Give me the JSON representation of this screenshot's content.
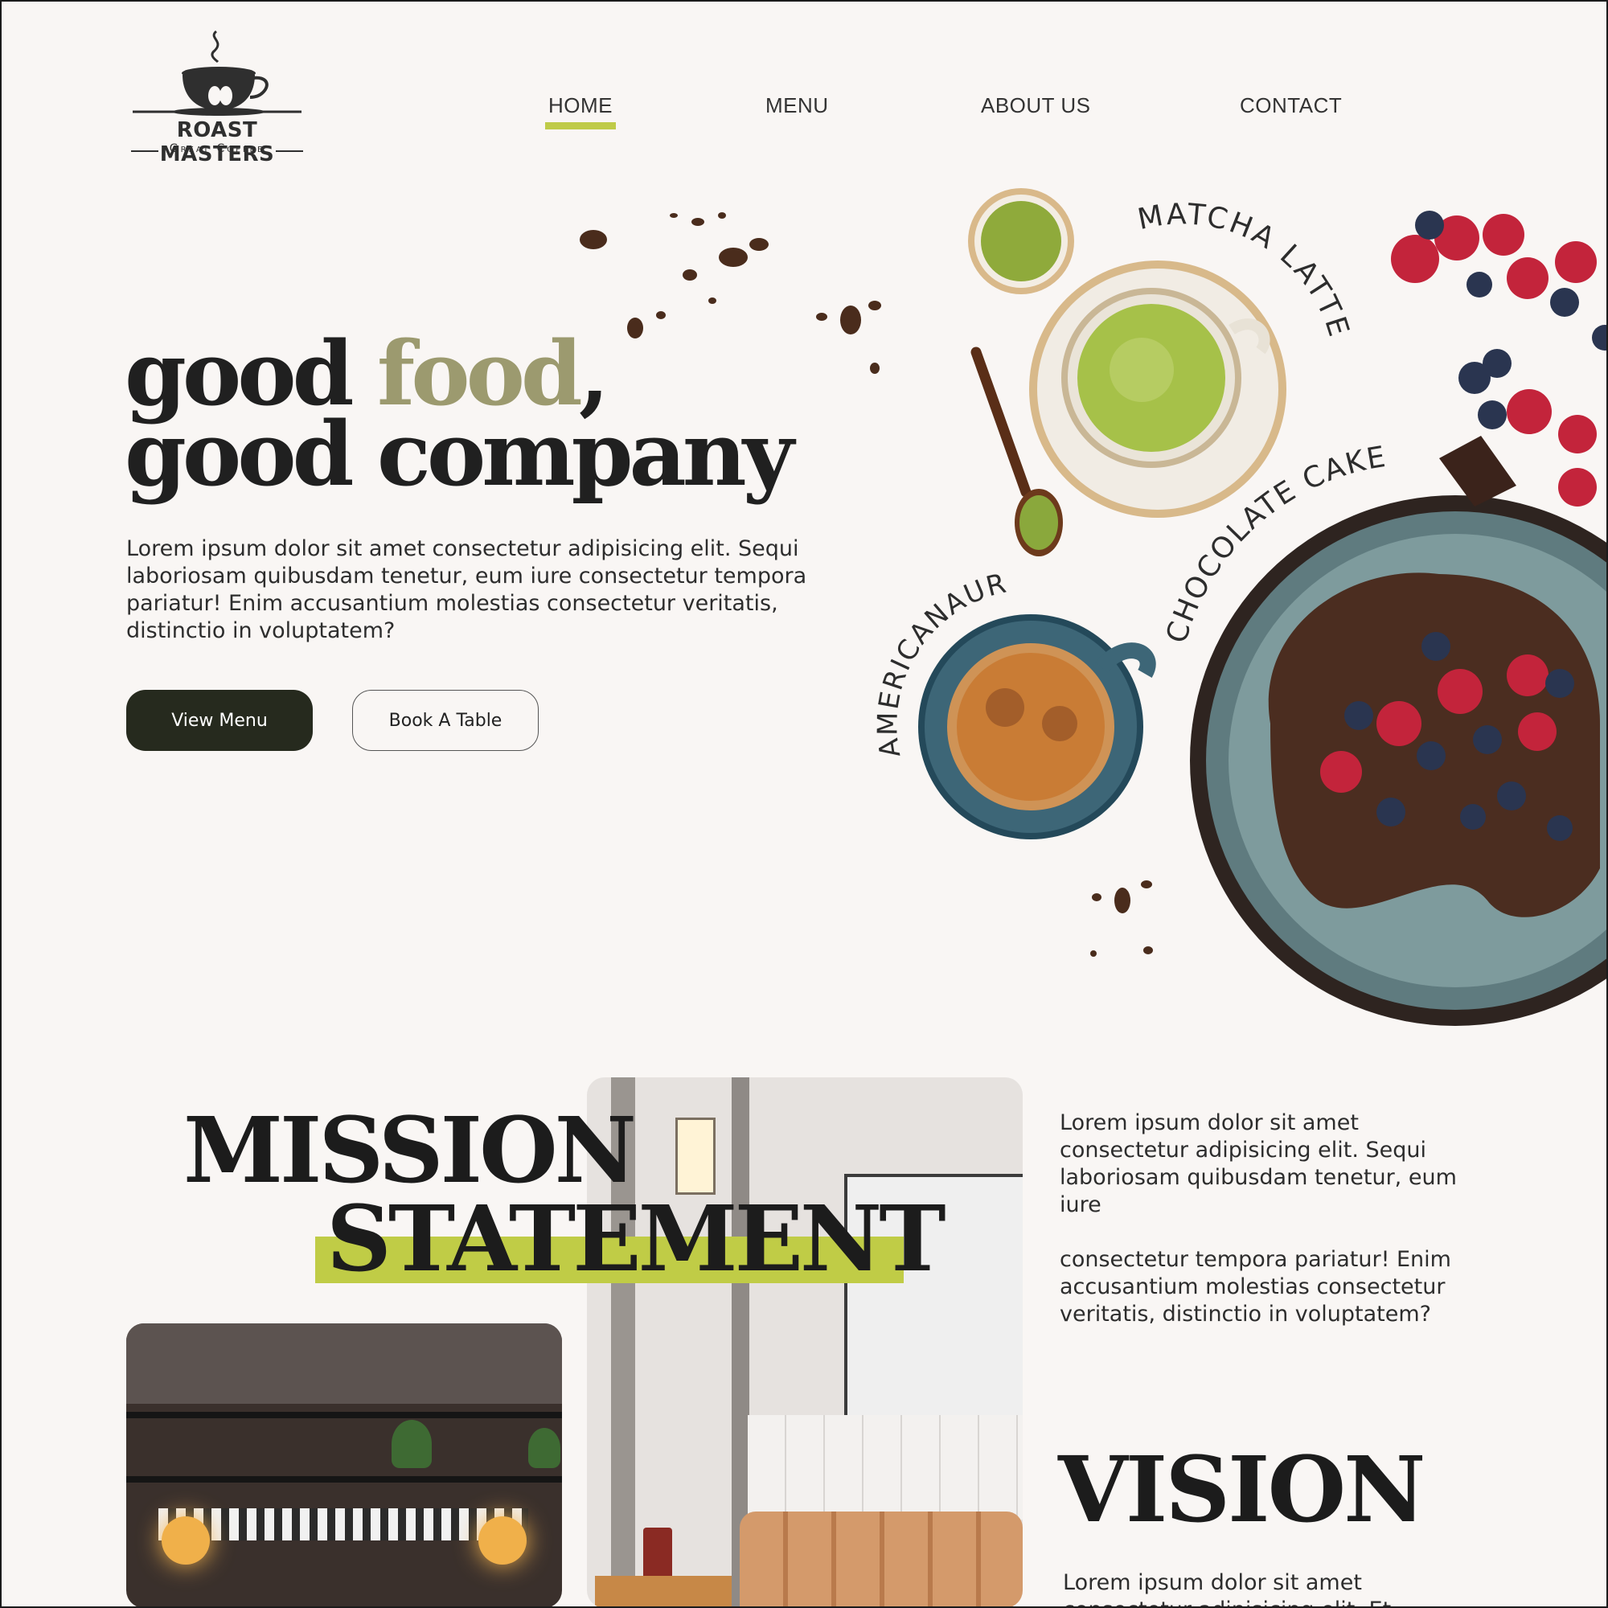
{
  "brand": {
    "name": "ROAST MASTERS",
    "tagline": "Great Coffee"
  },
  "nav": {
    "items": [
      {
        "label": "HOME",
        "active": true
      },
      {
        "label": "MENU",
        "active": false
      },
      {
        "label": "ABOUT US",
        "active": false
      },
      {
        "label": "CONTACT",
        "active": false
      }
    ]
  },
  "hero": {
    "headline_part1": "good ",
    "headline_accent": "food",
    "headline_part2": ",",
    "headline_line2": "good company",
    "body": "Lorem ipsum dolor sit amet consectetur adipisicing elit. Sequi laboriosam quibusdam tenetur, eum iure consectetur tempora pariatur! Enim accusantium molestias consectetur veritatis, distinctio in voluptatem?",
    "primary_button": "View Menu",
    "secondary_button": "Book A Table",
    "products": {
      "matcha": "MATCHA LATTE",
      "cake": "CHOCOLATE CAKE",
      "americano": "AMERICANAUR"
    }
  },
  "mission": {
    "title_line1": "MISSION",
    "title_line2": "STATEMENT",
    "body_1": "Lorem ipsum dolor sit amet consectetur adipisicing elit. Sequi laboriosam quibusdam tenetur, eum iure",
    "body_2": "consectetur tempora pariatur! Enim accusantium molestias consectetur veritatis, distinctio in voluptatem?"
  },
  "vision": {
    "title": "VISION",
    "body": "Lorem ipsum dolor sit amet consectetur adipisicing elit. Et..."
  },
  "colors": {
    "accent": "#bfcb48",
    "olive": "#9c9a6f",
    "dark": "#262a1e",
    "background": "#f9f6f4"
  },
  "icons": {
    "logo": "coffee-cup-icon"
  }
}
